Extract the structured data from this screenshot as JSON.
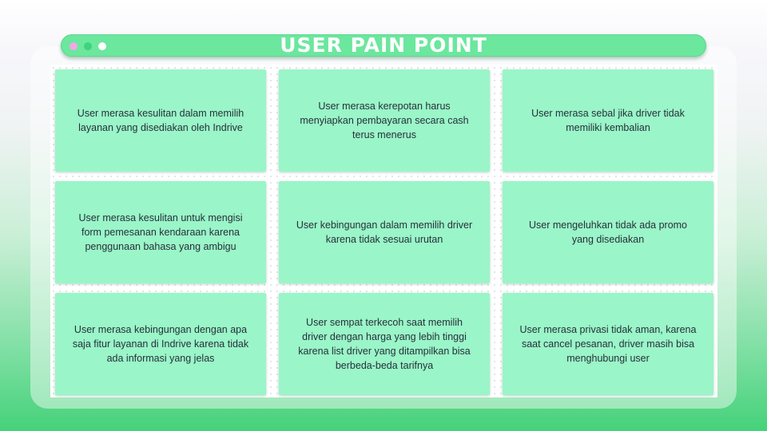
{
  "window": {
    "title": "USER PAIN POINT",
    "controls": [
      "close-dot",
      "minimize-dot",
      "maximize-dot"
    ]
  },
  "colors": {
    "background_top": "#f7f7fb",
    "background_bottom": "#45d27a",
    "title_bar": "#6be79e",
    "card": "#9af5c8",
    "text": "#26303a"
  },
  "cards": [
    {
      "text": "User merasa kesulitan dalam memilih layanan yang disediakan oleh Indrive"
    },
    {
      "text": "User merasa kerepotan harus menyiapkan pembayaran secara cash terus menerus"
    },
    {
      "text": "User merasa sebal jika driver tidak memiliki kembalian"
    },
    {
      "text": "User merasa kesulitan untuk mengisi form pemesanan kendaraan karena penggunaan bahasa yang ambigu"
    },
    {
      "text": "User kebingungan dalam memilih driver karena tidak sesuai urutan"
    },
    {
      "text": "User mengeluhkan tidak ada promo yang disediakan"
    },
    {
      "text": "User merasa kebingungan dengan apa saja fitur layanan di Indrive karena tidak ada informasi yang jelas"
    },
    {
      "text": "User sempat terkecoh saat memilih driver dengan harga yang lebih tinggi karena list driver yang ditampilkan bisa berbeda-beda tarifnya"
    },
    {
      "text": "User merasa privasi tidak aman, karena saat cancel pesanan, driver masih bisa menghubungi user"
    }
  ]
}
